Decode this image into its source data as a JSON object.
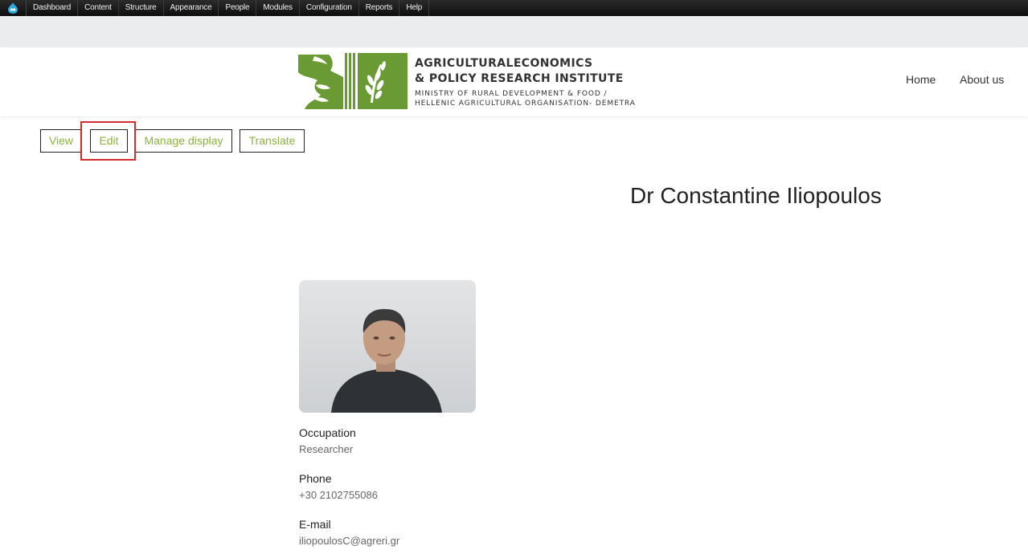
{
  "admin_toolbar": {
    "items": [
      "Dashboard",
      "Content",
      "Structure",
      "Appearance",
      "People",
      "Modules",
      "Configuration",
      "Reports",
      "Help"
    ]
  },
  "header": {
    "logo_text": {
      "line1": "AGRICULTURALECONOMICS",
      "line2": "& POLICY RESEARCH INSTITUTE",
      "line3": "MINISTRY OF RURAL DEVELOPMENT & FOOD /",
      "line4": "HELLENIC AGRICULTURAL ORGANISATION- DEMETRA"
    },
    "nav": {
      "home": "Home",
      "about": "About us"
    }
  },
  "tabs": {
    "view": "View",
    "edit": "Edit",
    "manage_display": "Manage display",
    "translate": "Translate"
  },
  "page": {
    "title": "Dr Constantine Iliopoulos"
  },
  "profile": {
    "occupation_label": "Occupation",
    "occupation_value": "Researcher",
    "phone_label": "Phone",
    "phone_value": "+30 2102755086",
    "email_label": "E-mail",
    "email_value": "iliopoulosC@agreri.gr"
  },
  "colors": {
    "brand_green": "#6a9a33",
    "link_green": "#8cb43a",
    "highlight_red": "#d62b2b"
  }
}
